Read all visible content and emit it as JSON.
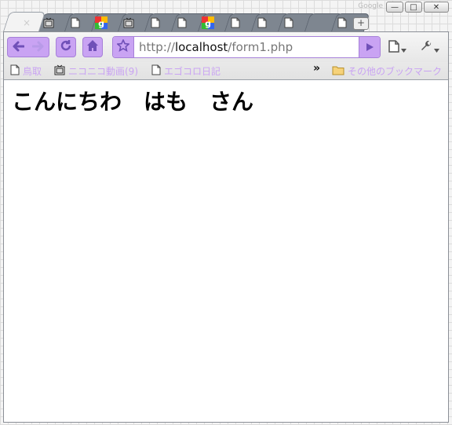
{
  "window": {
    "profile_hint": "Google",
    "controls": {
      "minimize": "—",
      "maximize": "□",
      "close": "✕"
    }
  },
  "tabs": [
    {
      "icon": "blank-tab",
      "active": true,
      "close_label": "×"
    },
    {
      "icon": "tv-icon"
    },
    {
      "icon": "page-icon"
    },
    {
      "icon": "google-icon"
    },
    {
      "icon": "tv-icon"
    },
    {
      "icon": "page-icon"
    },
    {
      "icon": "page-icon"
    },
    {
      "icon": "google-icon"
    },
    {
      "icon": "page-icon"
    },
    {
      "icon": "page-icon"
    },
    {
      "icon": "page-icon"
    },
    {
      "icon": "blank-tab"
    },
    {
      "icon": "page-icon"
    }
  ],
  "new_tab_label": "+",
  "toolbar": {
    "url_scheme": "http://",
    "url_host": "localhost",
    "url_path": "/form1.php",
    "accent": "#c9a3f3"
  },
  "bookmarks": {
    "items": [
      {
        "label": "鳥取",
        "icon": "page-icon"
      },
      {
        "label": "ニコニコ動画(9)",
        "icon": "tv-icon"
      },
      {
        "label": "エゴコロ日記",
        "icon": "page-icon"
      }
    ],
    "overflow": "»",
    "other_label": "その他のブックマーク",
    "other_icon": "folder-icon"
  },
  "page": {
    "text": "こんにちわ　はも　さん"
  }
}
